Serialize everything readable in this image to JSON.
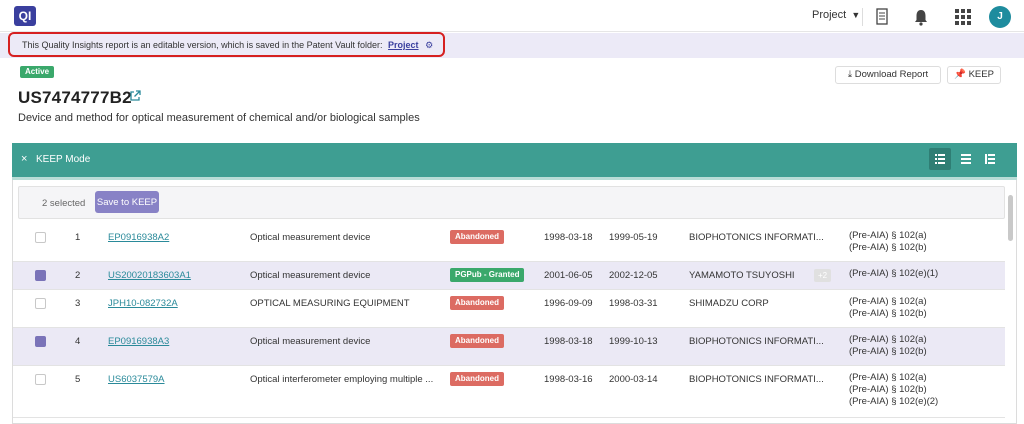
{
  "app": {
    "logo_text": "QI"
  },
  "topbar": {
    "project_label": "Project",
    "caret": "▼",
    "user_initial": "J"
  },
  "banner": {
    "text": "This Quality Insights report is an editable version, which is saved in the Patent Vault folder:",
    "link_label": "Project"
  },
  "header": {
    "status_badge": "Active",
    "patent_number": "US7474777B2",
    "description": "Device and method for optical measurement of chemical and/or biological samples",
    "download_label": "Download Report",
    "keep_label": "KEEP"
  },
  "keep_mode": {
    "close": "×",
    "title": "KEEP Mode",
    "selected_text": "2 selected",
    "save_label": "Save to KEEP"
  },
  "colors": {
    "brand": "#3a3f9e",
    "keep_bar": "#3e9e92",
    "abandoned": "#dc6b62",
    "granted": "#3aa86b",
    "selected_row": "#ebe9f5",
    "highlight_border": "#d62020"
  },
  "rows": [
    {
      "index": "1",
      "selected": false,
      "number": "EP0916938A2",
      "title": "Optical measurement device",
      "status": "Abandoned",
      "date1": "1998-03-18",
      "date2": "1999-05-19",
      "assignee": "BIOPHOTONICS INFORMATI...",
      "extra": "",
      "citations": [
        "(Pre-AIA) § 102(a)",
        "(Pre-AIA) § 102(b)"
      ]
    },
    {
      "index": "2",
      "selected": true,
      "number": "US20020183603A1",
      "title": "Optical measurement device",
      "status": "PGPub - Granted",
      "date1": "2001-06-05",
      "date2": "2002-12-05",
      "assignee": "YAMAMOTO TSUYOSHI",
      "extra": "+2",
      "citations": [
        "(Pre-AIA) § 102(e)(1)"
      ]
    },
    {
      "index": "3",
      "selected": false,
      "number": "JPH10-082732A",
      "title": "OPTICAL MEASURING EQUIPMENT",
      "status": "Abandoned",
      "date1": "1996-09-09",
      "date2": "1998-03-31",
      "assignee": "SHIMADZU CORP",
      "extra": "",
      "citations": [
        "(Pre-AIA) § 102(a)",
        "(Pre-AIA) § 102(b)"
      ]
    },
    {
      "index": "4",
      "selected": true,
      "number": "EP0916938A3",
      "title": "Optical measurement device",
      "status": "Abandoned",
      "date1": "1998-03-18",
      "date2": "1999-10-13",
      "assignee": "BIOPHOTONICS INFORMATI...",
      "extra": "",
      "citations": [
        "(Pre-AIA) § 102(a)",
        "(Pre-AIA) § 102(b)"
      ]
    },
    {
      "index": "5",
      "selected": false,
      "number": "US6037579A",
      "title": "Optical interferometer employing multiple ...",
      "status": "Abandoned",
      "date1": "1998-03-16",
      "date2": "2000-03-14",
      "assignee": "BIOPHOTONICS INFORMATI...",
      "extra": "",
      "citations": [
        "(Pre-AIA) § 102(a)",
        "(Pre-AIA) § 102(b)",
        "(Pre-AIA) § 102(e)(2)"
      ]
    }
  ]
}
